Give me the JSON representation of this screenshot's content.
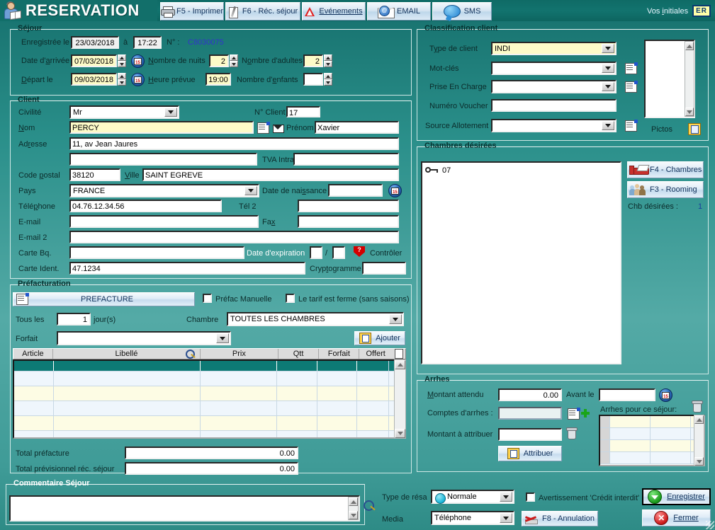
{
  "window": {
    "title": "RESERVATION",
    "initials_label": "Vos initiales",
    "initials_value": "ER"
  },
  "toolbar": [
    {
      "key": "print",
      "label": "F5 - Imprimer",
      "icon": "printer-icon"
    },
    {
      "key": "recap",
      "label": "F6 - Réc. séjour",
      "icon": "pen-document-icon"
    },
    {
      "key": "events",
      "label": "Evénements",
      "icon": "warning-triangle-icon"
    },
    {
      "key": "email",
      "label": "EMAIL",
      "icon": "email-icon"
    },
    {
      "key": "sms",
      "label": "SMS",
      "icon": "chat-bubble-icon"
    }
  ],
  "sejour": {
    "caption": "Séjour",
    "registered_label": "Enregistrée le",
    "registered_date": "23/03/2018",
    "at_label": "à",
    "registered_time": "17:22",
    "number_label": "N° :",
    "number_value": "C8030075",
    "arrival_label": "Date d'arrivée",
    "arrival_date": "07/03/2018",
    "nights_label": "Nombre de nuits",
    "nights_value": "2",
    "adults_label": "Nombre d'adultes",
    "adults_value": "2",
    "departure_label": "Départ le",
    "departure_date": "09/03/2018",
    "time_label": "Heure prévue",
    "time_value": "19:00",
    "children_label": "Nombre d'enfants",
    "children_value": ""
  },
  "client": {
    "caption": "Client",
    "civility_label": "Civilité",
    "civility_value": "Mr",
    "client_no_label": "N° Client",
    "client_no_value": "17",
    "name_label": "Nom",
    "name_value": "PERCY",
    "firstname_label": "Prénom",
    "firstname_value": "Xavier",
    "address_label": "Adresse",
    "address_line1": "11, av Jean Jaures",
    "address_line2": "",
    "tva_label": "TVA Intra",
    "tva_value": "",
    "zip_label": "Code postal",
    "zip_value": "38120",
    "city_label": "Ville",
    "city_value": "SAINT EGREVE",
    "country_label": "Pays",
    "country_value": "FRANCE",
    "birth_label": "Date de naissance",
    "birth_value": "",
    "phone_label": "Téléphone",
    "phone_value": "04.76.12.34.56",
    "phone2_label": "Tél 2",
    "phone2_value": "",
    "email_label": "E-mail",
    "email_value": "",
    "fax_label": "Fax",
    "fax_value": "",
    "email2_label": "E-mail 2",
    "email2_value": "",
    "card_label": "Carte Bq.",
    "card_value": "",
    "expiry_label": "Date d'expiration",
    "expiry_month": "",
    "expiry_sep": "/",
    "expiry_year": "",
    "control_label": "Contrôler",
    "idcard_label": "Carte Ident.",
    "idcard_value": "47.1234",
    "crypto_label": "Cryptogramme",
    "crypto_value": ""
  },
  "prefacturation": {
    "caption": "Préfacturation",
    "prefacture_button": "PREFACTURE",
    "manual_check_label": "Préfac Manuelle",
    "manual_checked": false,
    "firm_check_label": "Le tarif est ferme (sans saisons)",
    "firm_checked": false,
    "every_label": "Tous les",
    "every_value": "1",
    "days_label": "jour(s)",
    "room_label": "Chambre",
    "room_value": "TOUTES LES CHAMBRES",
    "package_label": "Forfait",
    "package_value": "",
    "add_button": "Ajouter",
    "columns": [
      "Article",
      "Libellé",
      "Prix",
      "Qtt",
      "Forfait",
      "Offert"
    ],
    "rows": [],
    "total_label": "Total préfacture",
    "total_value": "0.00",
    "forecast_label": "Total prévisionnel réc. séjour",
    "forecast_value": "0.00"
  },
  "classification": {
    "caption": "Classification client",
    "type_label": "Type de client",
    "type_value": "INDI",
    "keywords_label": "Mot-clés",
    "keywords_value": "",
    "charge_label": "Prise En Charge",
    "charge_value": "",
    "voucher_label": "Numéro Voucher",
    "voucher_value": "",
    "allotment_label": "Source Allotement",
    "allotment_value": "",
    "pictos_label": "Pictos"
  },
  "rooms": {
    "caption": "Chambres désirées",
    "items": [
      "07"
    ],
    "rooms_button": "F4 - Chambres",
    "rooming_button": "F3 - Rooming",
    "count_label": "Chb désirées :",
    "count_value": "1"
  },
  "arrhes": {
    "caption": "Arrhes",
    "expected_label": "Montant attendu",
    "expected_value": "0.00",
    "before_label": "Avant le",
    "before_value": "",
    "accounts_label": "Comptes d'arrhes :",
    "accounts_value": "",
    "assign_amount_label": "Montant à attribuer",
    "assign_amount_value": "",
    "assign_button": "Attribuer",
    "list_label": "Arrhes pour ce séjour:",
    "list_rows": [
      "",
      "",
      "",
      ""
    ]
  },
  "comment": {
    "caption": "Commentaire Séjour",
    "value": ""
  },
  "footer": {
    "resa_type_label": "Type de résa",
    "resa_type_value": "Normale",
    "media_label": "Media",
    "media_value": "Téléphone",
    "credit_warning_label": "Avertissement 'Crédit interdit'",
    "credit_warning_checked": false,
    "cancel_button": "F8 - Annulation",
    "save_button": "Enregistrer",
    "close_button": "Fermer"
  },
  "colors": {
    "background_teal": "#2e8b86",
    "header_teal": "#126f6a",
    "accent_yellow": "#fdfbc8",
    "link_blue": "#3333cc"
  }
}
